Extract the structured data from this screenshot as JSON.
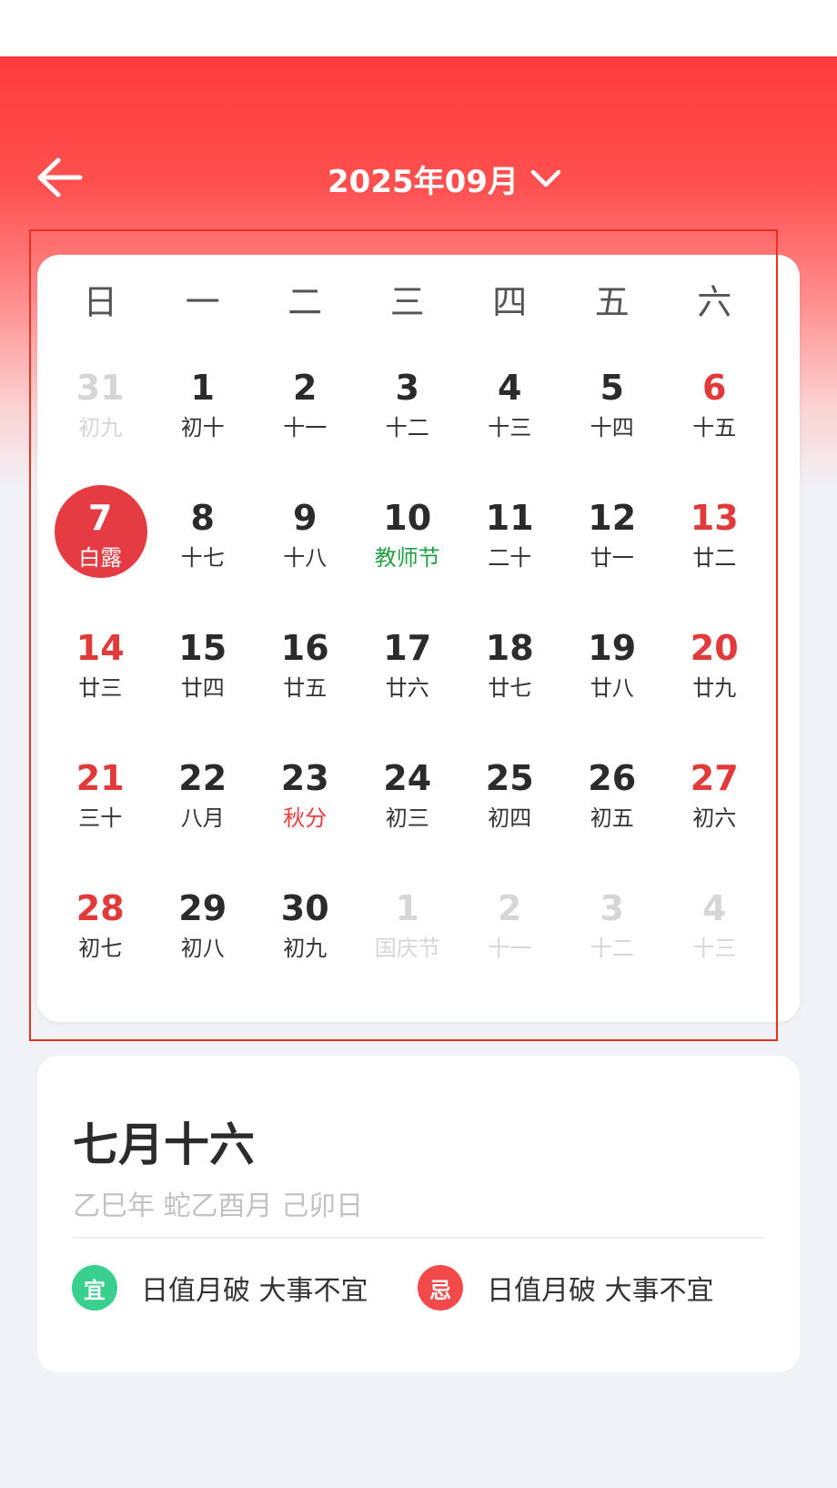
{
  "header": {
    "month_label": "2025年09月"
  },
  "weekdays": [
    "日",
    "一",
    "二",
    "三",
    "四",
    "五",
    "六"
  ],
  "days": [
    {
      "day": "31",
      "lunar": "初九",
      "type": "other"
    },
    {
      "day": "1",
      "lunar": "初十",
      "type": "normal"
    },
    {
      "day": "2",
      "lunar": "十一",
      "type": "normal"
    },
    {
      "day": "3",
      "lunar": "十二",
      "type": "normal"
    },
    {
      "day": "4",
      "lunar": "十三",
      "type": "normal"
    },
    {
      "day": "5",
      "lunar": "十四",
      "type": "normal"
    },
    {
      "day": "6",
      "lunar": "十五",
      "type": "weekend"
    },
    {
      "day": "7",
      "lunar": "白露",
      "type": "selected"
    },
    {
      "day": "8",
      "lunar": "十七",
      "type": "normal"
    },
    {
      "day": "9",
      "lunar": "十八",
      "type": "normal"
    },
    {
      "day": "10",
      "lunar": "教师节",
      "type": "fest-green"
    },
    {
      "day": "11",
      "lunar": "二十",
      "type": "normal"
    },
    {
      "day": "12",
      "lunar": "廿一",
      "type": "normal"
    },
    {
      "day": "13",
      "lunar": "廿二",
      "type": "weekend"
    },
    {
      "day": "14",
      "lunar": "廿三",
      "type": "weekend"
    },
    {
      "day": "15",
      "lunar": "廿四",
      "type": "normal"
    },
    {
      "day": "16",
      "lunar": "廿五",
      "type": "normal"
    },
    {
      "day": "17",
      "lunar": "廿六",
      "type": "normal"
    },
    {
      "day": "18",
      "lunar": "廿七",
      "type": "normal"
    },
    {
      "day": "19",
      "lunar": "廿八",
      "type": "normal"
    },
    {
      "day": "20",
      "lunar": "廿九",
      "type": "weekend"
    },
    {
      "day": "21",
      "lunar": "三十",
      "type": "weekend"
    },
    {
      "day": "22",
      "lunar": "八月",
      "type": "normal"
    },
    {
      "day": "23",
      "lunar": "秋分",
      "type": "fest-red"
    },
    {
      "day": "24",
      "lunar": "初三",
      "type": "normal"
    },
    {
      "day": "25",
      "lunar": "初四",
      "type": "normal"
    },
    {
      "day": "26",
      "lunar": "初五",
      "type": "normal"
    },
    {
      "day": "27",
      "lunar": "初六",
      "type": "weekend"
    },
    {
      "day": "28",
      "lunar": "初七",
      "type": "weekend"
    },
    {
      "day": "29",
      "lunar": "初八",
      "type": "normal"
    },
    {
      "day": "30",
      "lunar": "初九",
      "type": "normal"
    },
    {
      "day": "1",
      "lunar": "国庆节",
      "type": "other"
    },
    {
      "day": "2",
      "lunar": "十一",
      "type": "other"
    },
    {
      "day": "3",
      "lunar": "十二",
      "type": "other"
    },
    {
      "day": "4",
      "lunar": "十三",
      "type": "other"
    }
  ],
  "info": {
    "lunar_date": "七月十六",
    "ganzhi": "乙巳年 蛇乙酉月 己卯日",
    "yi_badge": "宜",
    "yi_text": "日值月破 大事不宜",
    "ji_badge": "忌",
    "ji_text": "日值月破 大事不宜"
  },
  "icons": {
    "back": "arrow-left-icon",
    "dropdown": "chevron-down-icon"
  },
  "colors": {
    "header_red": "#ff3b3b",
    "weekend_red": "#e03a3a",
    "selected_red": "#e43c42",
    "festival_green": "#21a045",
    "yi_green": "#39cf8e",
    "ji_red": "#f24a4a",
    "annotation_red": "#e8321f"
  }
}
